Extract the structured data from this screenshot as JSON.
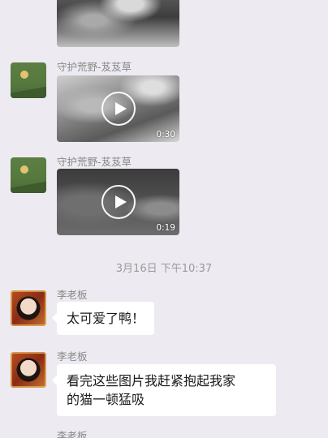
{
  "messages": [
    {
      "type": "video",
      "sender": "",
      "duration": ""
    },
    {
      "type": "video",
      "sender": "守护荒野-芨芨草",
      "duration": "0:30"
    },
    {
      "type": "video",
      "sender": "守护荒野-芨芨草",
      "duration": "0:19"
    },
    {
      "type": "timestamp",
      "text": "3月16日 下午10:37"
    },
    {
      "type": "text",
      "sender": "李老板",
      "text": "太可爱了鸭！"
    },
    {
      "type": "text",
      "sender": "李老板",
      "text_line1": "看完这些图片我赶紧抱起我家",
      "text_line2": "的猫一顿猛吸"
    },
    {
      "type": "text",
      "sender": "李老板"
    }
  ]
}
